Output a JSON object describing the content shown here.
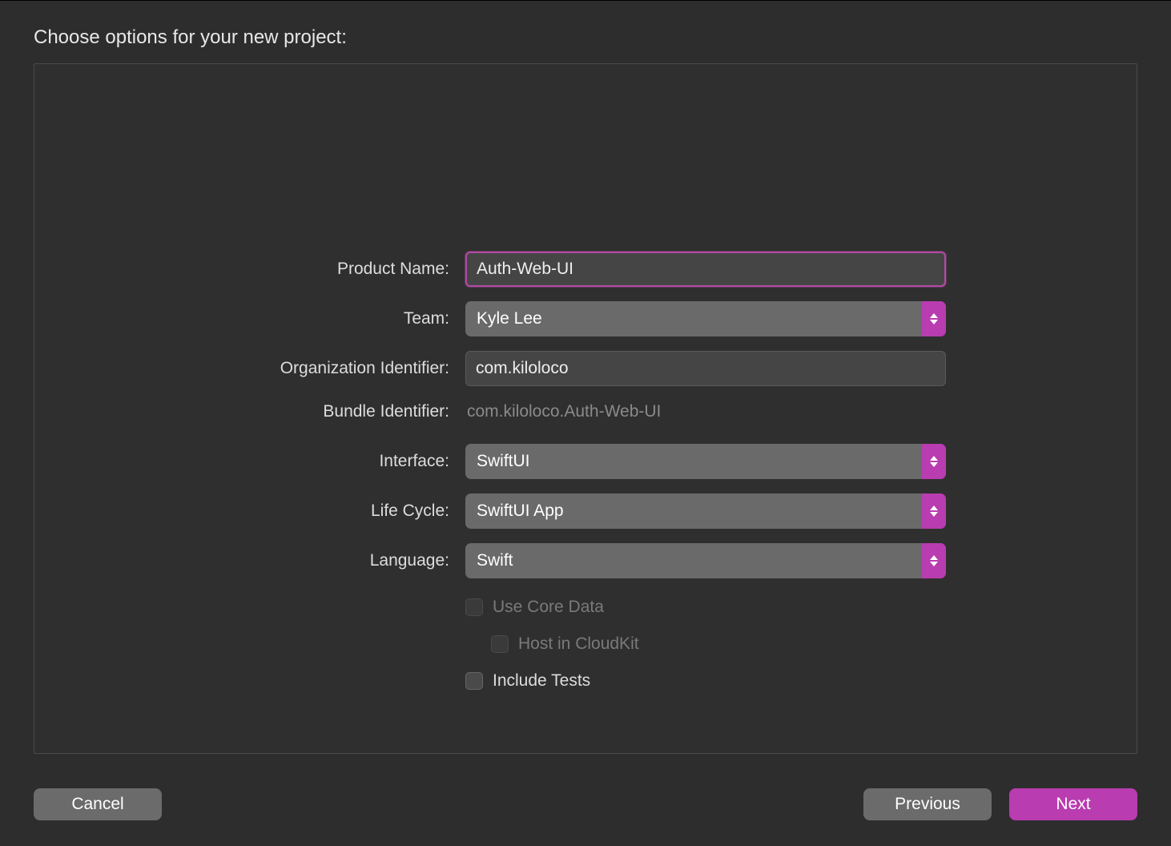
{
  "title": "Choose options for your new project:",
  "form": {
    "productName": {
      "label": "Product Name:",
      "value": "Auth-Web-UI"
    },
    "team": {
      "label": "Team:",
      "value": "Kyle Lee"
    },
    "orgId": {
      "label": "Organization Identifier:",
      "value": "com.kiloloco"
    },
    "bundleId": {
      "label": "Bundle Identifier:",
      "value": "com.kiloloco.Auth-Web-UI"
    },
    "interface": {
      "label": "Interface:",
      "value": "SwiftUI"
    },
    "lifeCycle": {
      "label": "Life Cycle:",
      "value": "SwiftUI App"
    },
    "language": {
      "label": "Language:",
      "value": "Swift"
    },
    "useCoreData": {
      "label": "Use Core Data",
      "checked": false,
      "enabled": false
    },
    "hostCloudKit": {
      "label": "Host in CloudKit",
      "checked": false,
      "enabled": false
    },
    "includeTests": {
      "label": "Include Tests",
      "checked": false,
      "enabled": true
    }
  },
  "buttons": {
    "cancel": "Cancel",
    "previous": "Previous",
    "next": "Next"
  },
  "colors": {
    "accent": "#b93cb0",
    "focusRing": "#b14aa3",
    "background": "#2d2d2d",
    "panelBorder": "#4a4a4a"
  }
}
